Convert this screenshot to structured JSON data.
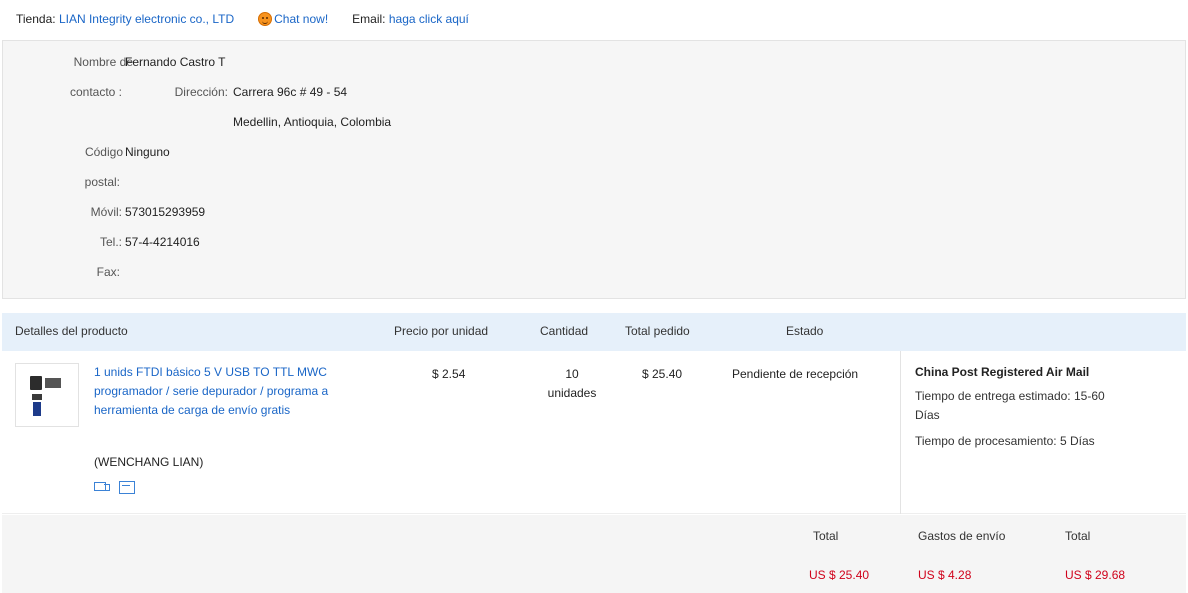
{
  "store": {
    "label": "Tienda:",
    "name": "LIAN Integrity electronic co., LTD",
    "chat": "Chat now!",
    "email_label": "Email:",
    "email_link": "haga click aquí"
  },
  "contact": {
    "name_label_1": "Nombre de",
    "name_label_2": "contacto :",
    "name_value": "Fernando Castro T",
    "address_label": "Dirección:",
    "address_line1": "Carrera 96c # 49 - 54",
    "address_line2": "Medellin, Antioquia, Colombia",
    "postal_label_1": "Código",
    "postal_label_2": "postal:",
    "postal_value": "Ninguno",
    "mobile_label": "Móvil:",
    "mobile_value": "573015293959",
    "phone_label": "Tel.:",
    "phone_value": "57-4-4214016",
    "fax_label": "Fax:",
    "fax_value": ""
  },
  "table": {
    "headers": {
      "product": "Detalles del producto",
      "unit_price": "Precio por unidad",
      "quantity": "Cantidad",
      "total": "Total pedido",
      "status": "Estado"
    },
    "row": {
      "product_name": "1 unids FTDI básico 5 V USB TO TTL MWC programador / serie depurador / programa a herramienta de carga de envío gratis",
      "seller": "(WENCHANG LIAN)",
      "unit_price": "$ 2.54",
      "quantity_num": "10",
      "quantity_unit": "unidades",
      "total": "$ 25.40",
      "status": "Pendiente de recepción",
      "shipping_method": "China Post Registered Air Mail",
      "delivery_estimate_1": "Tiempo de entrega estimado: 15-60",
      "delivery_estimate_2": "Días",
      "processing_time": "Tiempo de procesamiento: 5 Días"
    }
  },
  "totals": {
    "subtotal_label": "Total",
    "subtotal_value": "US $ 25.40",
    "shipping_label": "Gastos de envío",
    "shipping_value": "US $ 4.28",
    "grand_label": "Total",
    "grand_value": "US $ 29.68"
  },
  "colors": {
    "link": "#1a66c7",
    "price_red": "#d0021b",
    "header_bg": "#e6f0fa"
  },
  "icons": [
    "chat-icon",
    "truck-icon",
    "card-icon"
  ]
}
